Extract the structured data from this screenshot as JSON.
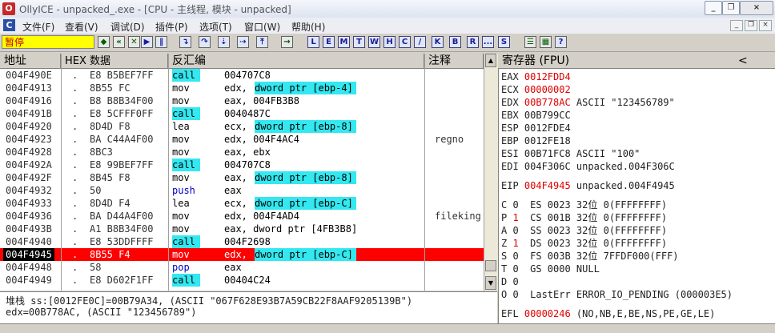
{
  "window": {
    "title": "OllyICE - unpacked_.exe - [CPU - 主线程, 模块 - unpacked]",
    "controls": {
      "minimize": "_",
      "restore": "❐",
      "close": "×"
    }
  },
  "menu": {
    "items": [
      "文件(F)",
      "查看(V)",
      "调试(D)",
      "插件(P)",
      "选项(T)",
      "窗口(W)",
      "帮助(H)"
    ]
  },
  "toolbar": {
    "status": "暂停",
    "letters": [
      "L",
      "E",
      "M",
      "T",
      "W",
      "H",
      "C",
      "/",
      "K",
      "B",
      "R",
      "...",
      "S"
    ]
  },
  "disasm": {
    "headers": {
      "address": "地址",
      "hex": "HEX 数据",
      "disassembly": "反汇编",
      "comment": "注释"
    },
    "rows": [
      {
        "addr": "004F490E",
        "dot": ".",
        "hex": "E8 B5BEF7FF",
        "mn": "call",
        "op": "004707C8",
        "opStyle": "plain",
        "cm": ""
      },
      {
        "addr": "004F4913",
        "dot": ".",
        "hex": "8B55 FC",
        "mn": "mov",
        "op": "edx,",
        "mem": "dword ptr [ebp-4]",
        "cm": ""
      },
      {
        "addr": "004F4916",
        "dot": ".",
        "hex": "B8 B8B34F00",
        "mn": "mov",
        "op": "eax, 004FB3B8",
        "cm": ""
      },
      {
        "addr": "004F491B",
        "dot": ".",
        "hex": "E8 5CFFF0FF",
        "mn": "call",
        "op": "0040487C",
        "cm": ""
      },
      {
        "addr": "004F4920",
        "dot": ".",
        "hex": "8D4D F8",
        "mn": "lea",
        "op": "ecx,",
        "mem": "dword ptr [ebp-8]",
        "cm": ""
      },
      {
        "addr": "004F4923",
        "dot": ".",
        "hex": "BA C44A4F00",
        "mn": "mov",
        "op": "edx, 004F4AC4",
        "cm": "regno"
      },
      {
        "addr": "004F4928",
        "dot": ".",
        "hex": "8BC3",
        "mn": "mov",
        "op": "eax, ebx",
        "cm": ""
      },
      {
        "addr": "004F492A",
        "dot": ".",
        "hex": "E8 99BEF7FF",
        "mn": "call",
        "op": "004707C8",
        "cm": ""
      },
      {
        "addr": "004F492F",
        "dot": ".",
        "hex": "8B45 F8",
        "mn": "mov",
        "op": "eax,",
        "mem": "dword ptr [ebp-8]",
        "cm": ""
      },
      {
        "addr": "004F4932",
        "dot": ".",
        "hex": "50",
        "mn": "push",
        "op": "eax",
        "cm": ""
      },
      {
        "addr": "004F4933",
        "dot": ".",
        "hex": "8D4D F4",
        "mn": "lea",
        "op": "ecx,",
        "mem": "dword ptr [ebp-C]",
        "cm": ""
      },
      {
        "addr": "004F4936",
        "dot": ".",
        "hex": "BA D44A4F00",
        "mn": "mov",
        "op": "edx, 004F4AD4",
        "cm": "fileking"
      },
      {
        "addr": "004F493B",
        "dot": ".",
        "hex": "A1 B8B34F00",
        "mn": "mov",
        "op": "eax, dword ptr [4FB3B8]",
        "cm": ""
      },
      {
        "addr": "004F4940",
        "dot": ".",
        "hex": "E8 53DDFFFF",
        "mn": "call",
        "op": "004F2698",
        "cm": ""
      },
      {
        "addr": "004F4945",
        "dot": ".",
        "hex": "8B55 F4",
        "mn": "mov",
        "op": "edx,",
        "mem": "dword ptr [ebp-C]",
        "cm": "",
        "current": true
      },
      {
        "addr": "004F4948",
        "dot": ".",
        "hex": "58",
        "mn": "pop",
        "op": "eax",
        "cm": ""
      },
      {
        "addr": "004F4949",
        "dot": ".",
        "hex": "E8 D602F1FF",
        "mn": "call",
        "op": "00404C24",
        "cm": ""
      }
    ]
  },
  "info": {
    "line1": "堆栈 ss:[0012FE0C]=00B79A34, (ASCII \"067F628E93B7A59CB22F8AAF9205139B\")",
    "line2": "edx=00B778AC, (ASCII \"123456789\")"
  },
  "registers": {
    "header": "寄存器 (FPU)",
    "header_arrow": "<",
    "rows": [
      {
        "name": "EAX",
        "value": "0012FDD4",
        "extra": "",
        "hl": true
      },
      {
        "name": "ECX",
        "value": "00000002",
        "extra": "",
        "hl": true
      },
      {
        "name": "EDX",
        "value": "00B778AC",
        "extra": "ASCII \"123456789\"",
        "hl": true
      },
      {
        "name": "EBX",
        "value": "00B799CC",
        "extra": "",
        "hl": false
      },
      {
        "name": "ESP",
        "value": "0012FDE4",
        "extra": "",
        "hl": false
      },
      {
        "name": "EBP",
        "value": "0012FE18",
        "extra": "",
        "hl": false
      },
      {
        "name": "ESI",
        "value": "00B71FC8",
        "extra": "ASCII \"100\"",
        "hl": false
      },
      {
        "name": "EDI",
        "value": "004F306C",
        "extra": "unpacked.004F306C",
        "hl": false
      }
    ],
    "eip": {
      "name": "EIP",
      "value": "004F4945",
      "extra": "unpacked.004F4945"
    },
    "flags": [
      {
        "f": "C",
        "v": "0",
        "seg": "ES",
        "sel": "0023",
        "info": "32位 0(FFFFFFFF)",
        "hl": false
      },
      {
        "f": "P",
        "v": "1",
        "seg": "CS",
        "sel": "001B",
        "info": "32位 0(FFFFFFFF)",
        "hl": true
      },
      {
        "f": "A",
        "v": "0",
        "seg": "SS",
        "sel": "0023",
        "info": "32位 0(FFFFFFFF)",
        "hl": false
      },
      {
        "f": "Z",
        "v": "1",
        "seg": "DS",
        "sel": "0023",
        "info": "32位 0(FFFFFFFF)",
        "hl": true
      },
      {
        "f": "S",
        "v": "0",
        "seg": "FS",
        "sel": "003B",
        "info": "32位 7FFDF000(FFF)",
        "hl": false
      },
      {
        "f": "T",
        "v": "0",
        "seg": "GS",
        "sel": "0000",
        "info": "NULL",
        "hl": false
      },
      {
        "f": "D",
        "v": "0",
        "seg": "",
        "sel": "",
        "info": "",
        "hl": false
      },
      {
        "f": "O",
        "v": "0",
        "seg": "",
        "sel": "",
        "info": "LastErr ERROR_IO_PENDING (000003E5)",
        "hl": false
      }
    ],
    "efl": {
      "name": "EFL",
      "value": "00000246",
      "extra": "(NO,NB,E,BE,NS,PE,GE,LE)"
    }
  },
  "colors": {
    "current_line": "#ff0000",
    "memory_operand": "#33e8f0",
    "call_bg": "#33e8f0",
    "status_bg": "#ffff00",
    "status_fg": "#c00000"
  }
}
